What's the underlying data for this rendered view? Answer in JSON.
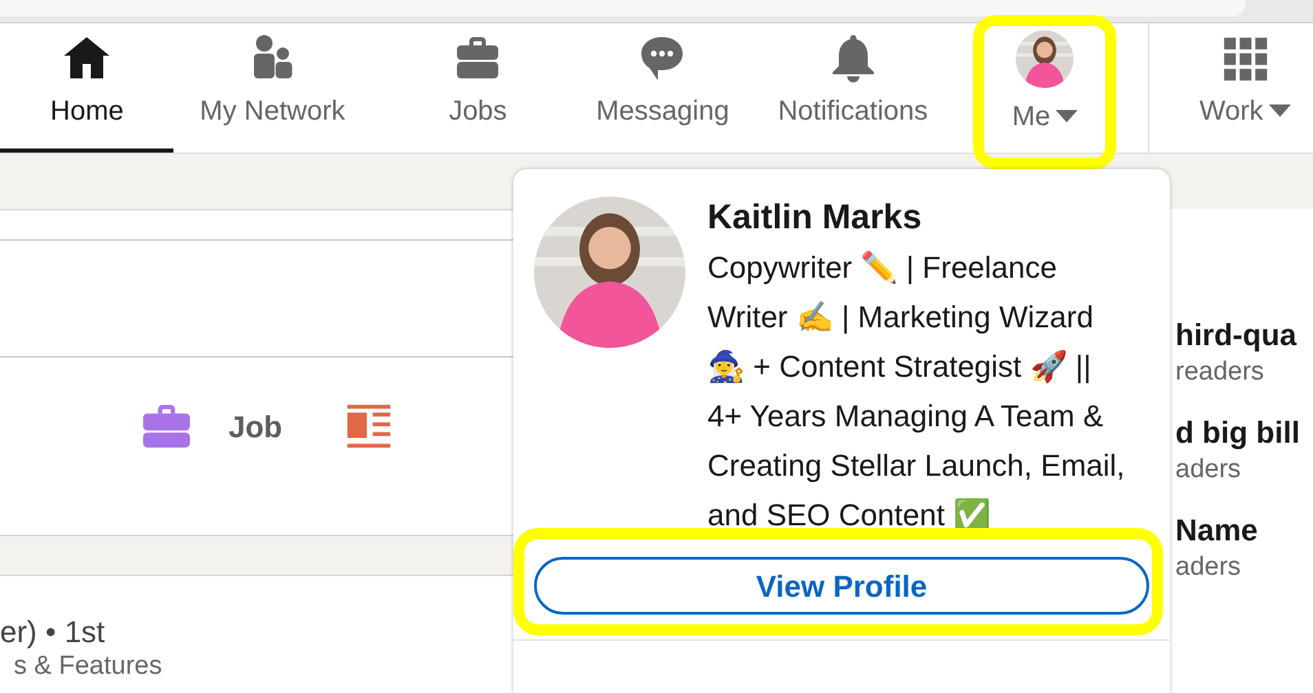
{
  "nav": [
    {
      "kind": "home",
      "label": "Home",
      "selected": true,
      "highlighted": false
    },
    {
      "kind": "network",
      "label": "My Network",
      "selected": false,
      "highlighted": false
    },
    {
      "kind": "jobs",
      "label": "Jobs",
      "selected": false,
      "highlighted": false
    },
    {
      "kind": "messaging",
      "label": "Messaging",
      "selected": false,
      "highlighted": false
    },
    {
      "kind": "notifications",
      "label": "Notifications",
      "selected": false,
      "highlighted": false
    },
    {
      "kind": "me",
      "label": "Me",
      "selected": false,
      "highlighted": true
    },
    {
      "kind": "work",
      "label": "Work",
      "selected": false,
      "highlighted": false
    }
  ],
  "composer": {
    "actions": [
      {
        "kind": "job",
        "label": "Job"
      },
      {
        "kind": "article"
      }
    ]
  },
  "feed_post": {
    "byline": "er) • 1st",
    "subtitle": "s & Features"
  },
  "news": [
    {
      "title": "hird-qua",
      "meta": "readers"
    },
    {
      "title": "d big bill",
      "meta": "aders"
    },
    {
      "title": "Name",
      "meta": "aders"
    }
  ],
  "me_menu": {
    "name": "Kaitlin Marks",
    "headline": "Copywriter ✏️ | Freelance Writer ✍️ | Marketing Wizard 🧙‍♀️ + Content Strategist 🚀 || 4+ Years Managing A Team & Creating Stellar Launch, Email, and SEO Content ✅",
    "button": {
      "label": "View Profile",
      "highlighted": true
    }
  }
}
